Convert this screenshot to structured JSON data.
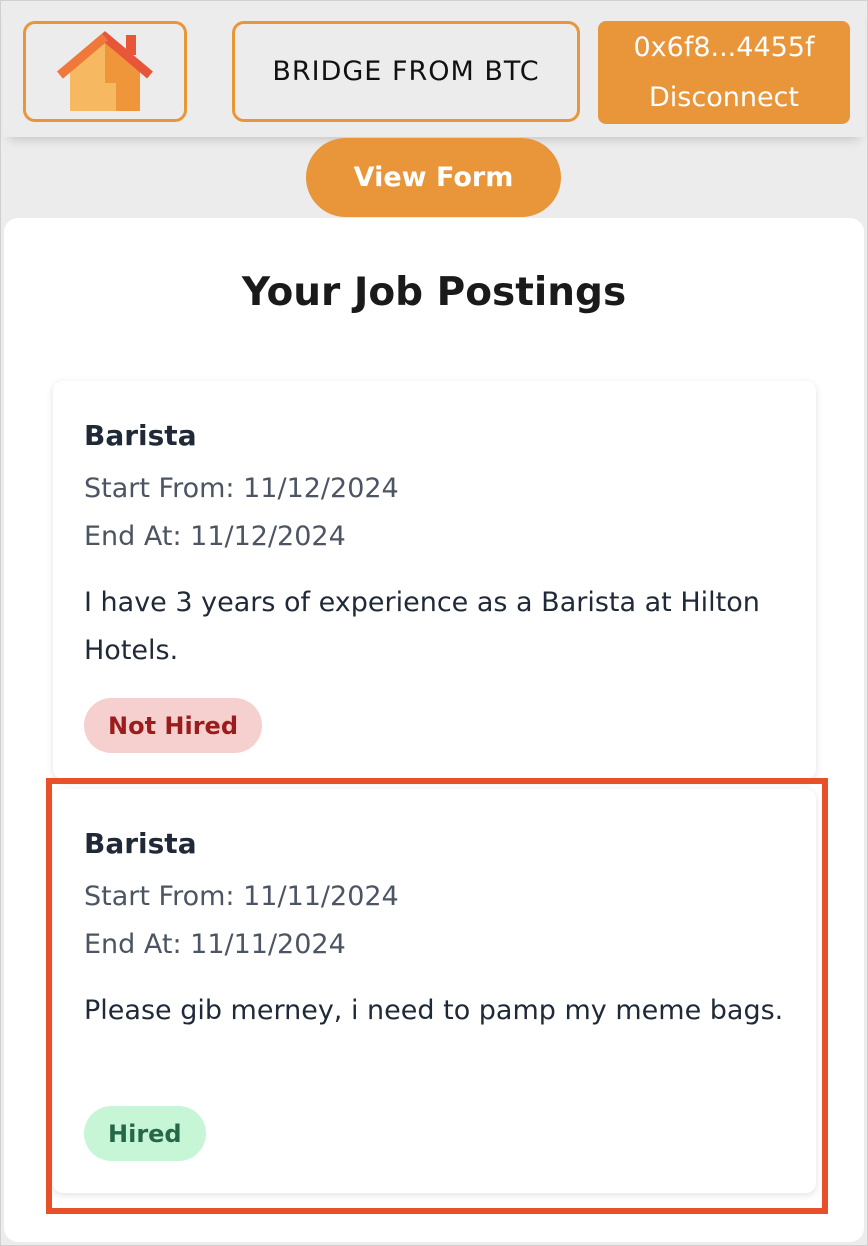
{
  "header": {
    "home_icon": "house-icon",
    "bridge_label": "BRIDGE FROM BTC",
    "wallet_address": "0x6f8...4455f",
    "wallet_action": "Disconnect"
  },
  "view_form_label": "View Form",
  "page_title": "Your Job Postings",
  "postings": [
    {
      "title": "Barista",
      "start": "Start From: 11/12/2024",
      "end": "End At: 11/12/2024",
      "description": "I have 3 years of experience as a Barista at Hilton Hotels.",
      "status": "Not Hired"
    },
    {
      "title": "Barista",
      "start": "Start From: 11/11/2024",
      "end": "End At: 11/11/2024",
      "description": "Please gib merney, i need to pamp my meme bags.",
      "status": "Hired"
    }
  ],
  "colors": {
    "accent": "#e9963a",
    "highlight": "#e8502a",
    "not_hired_bg": "#f6cfcf",
    "hired_bg": "#c6f6d5"
  }
}
